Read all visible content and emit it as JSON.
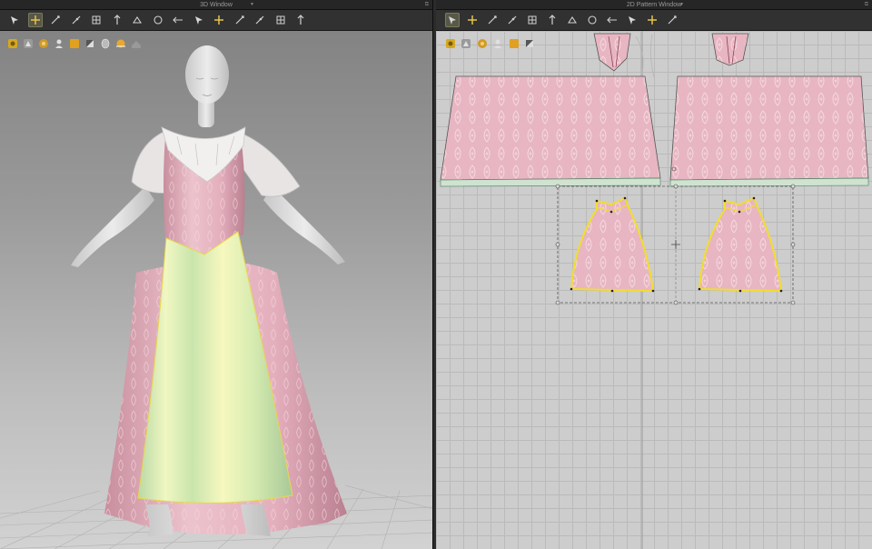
{
  "window_3d": {
    "title": "3D Window",
    "toolbar": [
      "select-mesh-icon",
      "move-arrow-icon",
      "edit-point-icon",
      "sewing-icon",
      "pin-icon",
      "fold-arrange-icon",
      "arrangement-point-icon",
      "mesh-grid-icon",
      "fold-icon",
      "steam-icon",
      "measure-icon",
      "tape-icon",
      "cut-icon",
      "tuck-icon",
      "sewing-line-icon"
    ],
    "active_tool": "move-arrow-icon",
    "viewport_toolbar": [
      "avatar-display-icon",
      "garment-display-icon",
      "texture-icon",
      "avatar-icon",
      "fabric-icon",
      "shading-icon",
      "xray-icon",
      "light-icon",
      "camera-icon"
    ]
  },
  "window_2d": {
    "title": "2D Pattern Window",
    "toolbar": [
      "transform-pattern-icon",
      "edit-curve-icon",
      "polygon-icon",
      "rectangle-icon",
      "internal-line-icon",
      "seam-icon",
      "dart-icon",
      "segment-sewing-icon",
      "free-sewing-icon",
      "fold-sewing-icon",
      "edit-sewing-icon",
      "garment-icon"
    ],
    "active_tool": "transform-pattern-icon",
    "viewport_toolbar": [
      "pen-icon",
      "arrange-icon",
      "sticky-icon",
      "pattern-icon",
      "layer-icon",
      "export-icon"
    ]
  },
  "colors": {
    "fabric_pink": "#e7b6c2",
    "skirt_yellow_green": "#e9f2a8",
    "selection_outline": "#f1de2c",
    "panel_bg": "#313131"
  }
}
